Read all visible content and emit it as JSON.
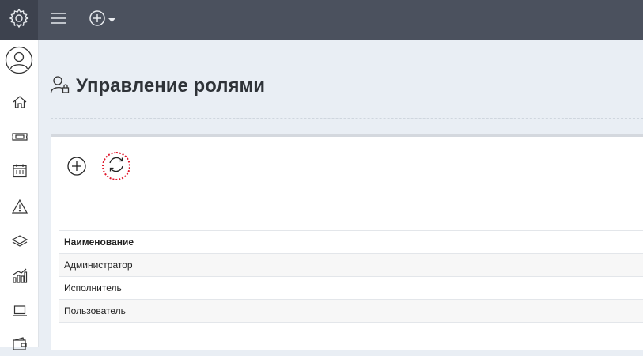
{
  "topbar": {
    "settings_icon": "gear-icon",
    "menu_icon": "hamburger-icon",
    "add_icon": "plus-circle-icon",
    "add_dropdown_icon": "caret-down-icon",
    "background": "#4b515e"
  },
  "sidebar": {
    "items": [
      {
        "icon": "user-circle-icon"
      },
      {
        "icon": "home-icon"
      },
      {
        "icon": "ticket-icon"
      },
      {
        "icon": "calendar-icon"
      },
      {
        "icon": "warning-icon"
      },
      {
        "icon": "layers-icon"
      },
      {
        "icon": "chart-icon"
      },
      {
        "icon": "laptop-icon"
      },
      {
        "icon": "wallet-icon"
      }
    ]
  },
  "page": {
    "title": "Управление ролями",
    "title_icon": "user-lock-icon"
  },
  "toolbar": {
    "add_icon": "plus-circle-icon",
    "refresh_icon": "refresh-icon",
    "refresh_highlight_color": "#e0162b"
  },
  "table": {
    "columns": [
      "Наименование"
    ],
    "rows": [
      [
        "Администратор"
      ],
      [
        "Исполнитель"
      ],
      [
        "Пользователь"
      ]
    ]
  }
}
